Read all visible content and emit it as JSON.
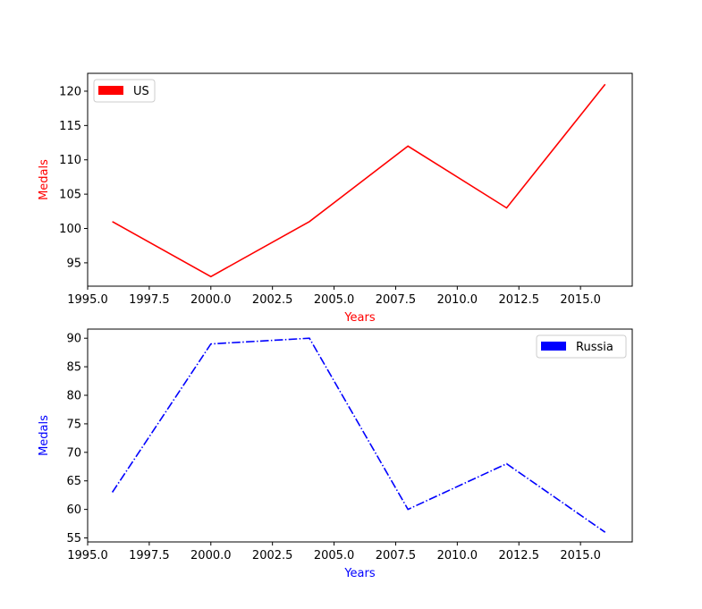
{
  "chart_data": [
    {
      "type": "line",
      "name": "us",
      "x": [
        1996,
        2000,
        2004,
        2008,
        2012,
        2016
      ],
      "series": [
        {
          "name": "US",
          "values": [
            101,
            93,
            101,
            112,
            103,
            121
          ],
          "color": "#ff0000",
          "linestyle": "solid"
        }
      ],
      "xlabel": "Years",
      "ylabel": "Medals",
      "label_color": "#ff0000",
      "xlim": [
        1995,
        2017.1
      ],
      "ylim": [
        91.6,
        122.6
      ],
      "xticks": [
        1995.0,
        1997.5,
        2000.0,
        2002.5,
        2005.0,
        2007.5,
        2010.0,
        2012.5,
        2015.0
      ],
      "xtick_labels": [
        "1995.0",
        "1997.5",
        "2000.0",
        "2002.5",
        "2005.0",
        "2007.5",
        "2010.0",
        "2012.5",
        "2015.0"
      ],
      "yticks": [
        95,
        100,
        105,
        110,
        115,
        120
      ],
      "ytick_labels": [
        "95",
        "100",
        "105",
        "110",
        "115",
        "120"
      ],
      "legend": {
        "label": "US",
        "position": "upper-left",
        "color": "#ff0000"
      },
      "grid": false
    },
    {
      "type": "line",
      "name": "russia",
      "x": [
        1996,
        2000,
        2004,
        2008,
        2012,
        2016
      ],
      "series": [
        {
          "name": "Russia",
          "values": [
            63,
            89,
            90,
            60,
            68,
            56
          ],
          "color": "#0000ff",
          "linestyle": "dashdot"
        }
      ],
      "xlabel": "Years",
      "ylabel": "Medals",
      "label_color": "#0000ff",
      "xlim": [
        1995,
        2017.1
      ],
      "ylim": [
        54.3,
        91.6
      ],
      "xticks": [
        1995.0,
        1997.5,
        2000.0,
        2002.5,
        2005.0,
        2007.5,
        2010.0,
        2012.5,
        2015.0
      ],
      "xtick_labels": [
        "1995.0",
        "1997.5",
        "2000.0",
        "2002.5",
        "2005.0",
        "2007.5",
        "2010.0",
        "2012.5",
        "2015.0"
      ],
      "yticks": [
        55,
        60,
        65,
        70,
        75,
        80,
        85,
        90
      ],
      "ytick_labels": [
        "55",
        "60",
        "65",
        "70",
        "75",
        "80",
        "85",
        "90"
      ],
      "legend": {
        "label": "Russia",
        "position": "upper-right",
        "color": "#0000ff"
      },
      "grid": false
    }
  ]
}
